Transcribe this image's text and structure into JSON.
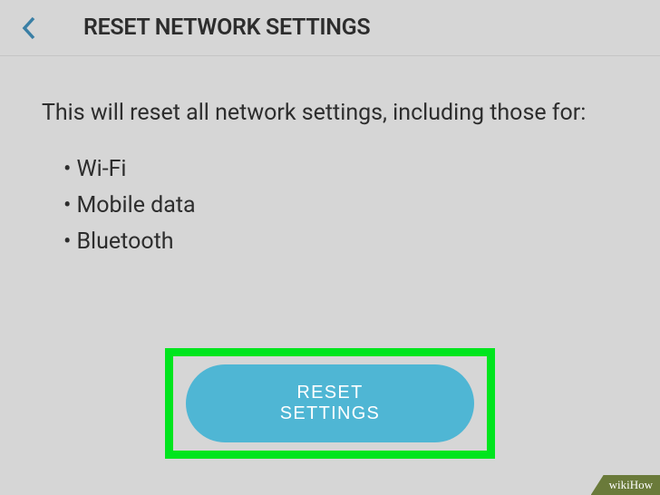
{
  "header": {
    "title": "RESET NETWORK SETTINGS"
  },
  "content": {
    "description": "This will reset all network settings, including those for:",
    "items": [
      "Wi-Fi",
      "Mobile data",
      "Bluetooth"
    ]
  },
  "button": {
    "label": "RESET SETTINGS"
  },
  "watermark": "wikiHow"
}
